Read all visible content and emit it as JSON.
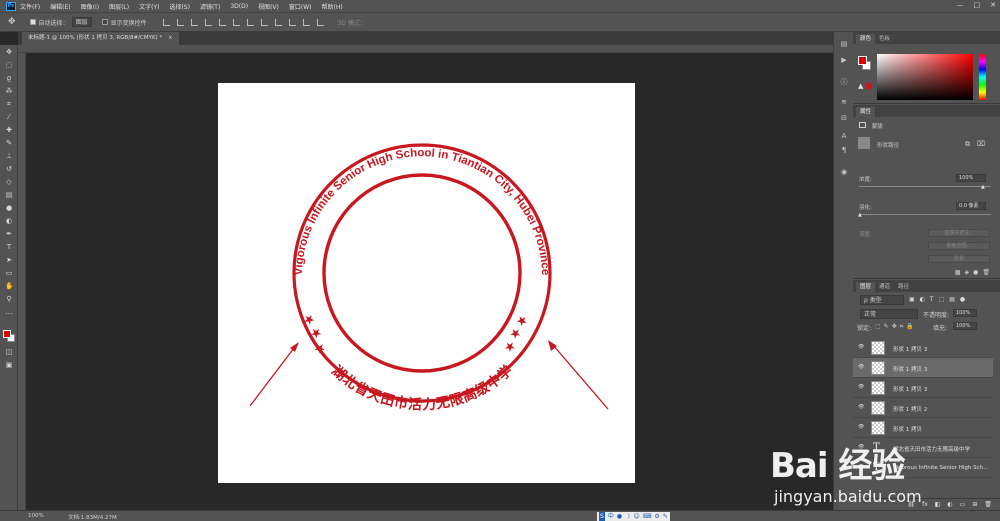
{
  "menubar": {
    "logo": "Ps",
    "items": [
      "文件(F)",
      "编辑(E)",
      "图像(I)",
      "图层(L)",
      "文字(Y)",
      "选择(S)",
      "滤镜(T)",
      "3D(D)",
      "视图(V)",
      "窗口(W)",
      "帮助(H)"
    ],
    "window_buttons": [
      "—",
      "□",
      "✕"
    ]
  },
  "options": {
    "auto_select_label": "自动选择：",
    "auto_select_value": "图层",
    "show_transform_label": "显示变换控件",
    "mode_3d_label": "3D 模式："
  },
  "document": {
    "tab_title": "未标题-1 @ 100% (形状 1 拷贝 3, RGB/8#/CMYK) *",
    "close": "×"
  },
  "artwork": {
    "top_arc_text": "Vigorous Infinite Senior High School in Tiantian City, Hubei Province",
    "bottom_arc_text": "湖北省天田市活力无限高级中学",
    "star": "★",
    "ring_color": "#c8171e",
    "arrow_color": "#c8171e"
  },
  "status": {
    "zoom": "100%",
    "doc_size": "文档:1.83M/4.27M",
    "ime": [
      "中",
      "●",
      "☽",
      "☺",
      "⌨",
      "⚙",
      "✎"
    ]
  },
  "color_panel": {
    "tabs": [
      "颜色",
      "色板"
    ],
    "foreground": "#e00000",
    "background": "#ffffff"
  },
  "properties_panel": {
    "tab": "属性",
    "mask_label": "蒙版",
    "shape_label": "形状路径",
    "density_label": "浓度:",
    "density_value": "100%",
    "feather_label": "羽化:",
    "feather_value": "0.0 像素",
    "refine_label": "调整:",
    "select_mask_button": "选择并遮住...",
    "color_range_button": "颜色范围...",
    "invert_button": "反相"
  },
  "layers_panel": {
    "tabs": [
      "图层",
      "通道",
      "路径"
    ],
    "filter_type": "ρ 类型",
    "blend_mode": "正常",
    "opacity_label": "不透明度:",
    "opacity_value": "100%",
    "lock_label": "锁定:",
    "fill_label": "填充:",
    "fill_value": "100%",
    "layers": [
      {
        "name": "形状 1 拷贝 3",
        "type": "shape",
        "selected": false
      },
      {
        "name": "形状 1 拷贝 3",
        "type": "shape",
        "selected": true
      },
      {
        "name": "形状 1 拷贝 3",
        "type": "shape",
        "selected": false
      },
      {
        "name": "形状 1 拷贝 2",
        "type": "shape",
        "selected": false
      },
      {
        "name": "形状 1 拷贝",
        "type": "shape",
        "selected": false
      },
      {
        "name": "湖北省天田市活力无限高级中学",
        "type": "text",
        "selected": false
      },
      {
        "name": "Vigorous Infinite Senior High Sch...",
        "type": "text",
        "selected": false
      }
    ],
    "footer_icons": [
      "⛓",
      "fx",
      "◧",
      "◐",
      "▭",
      "⊞",
      "🗑"
    ]
  },
  "watermark": {
    "brand": "Bai 经验",
    "url": "jingyan.baidu.com"
  }
}
